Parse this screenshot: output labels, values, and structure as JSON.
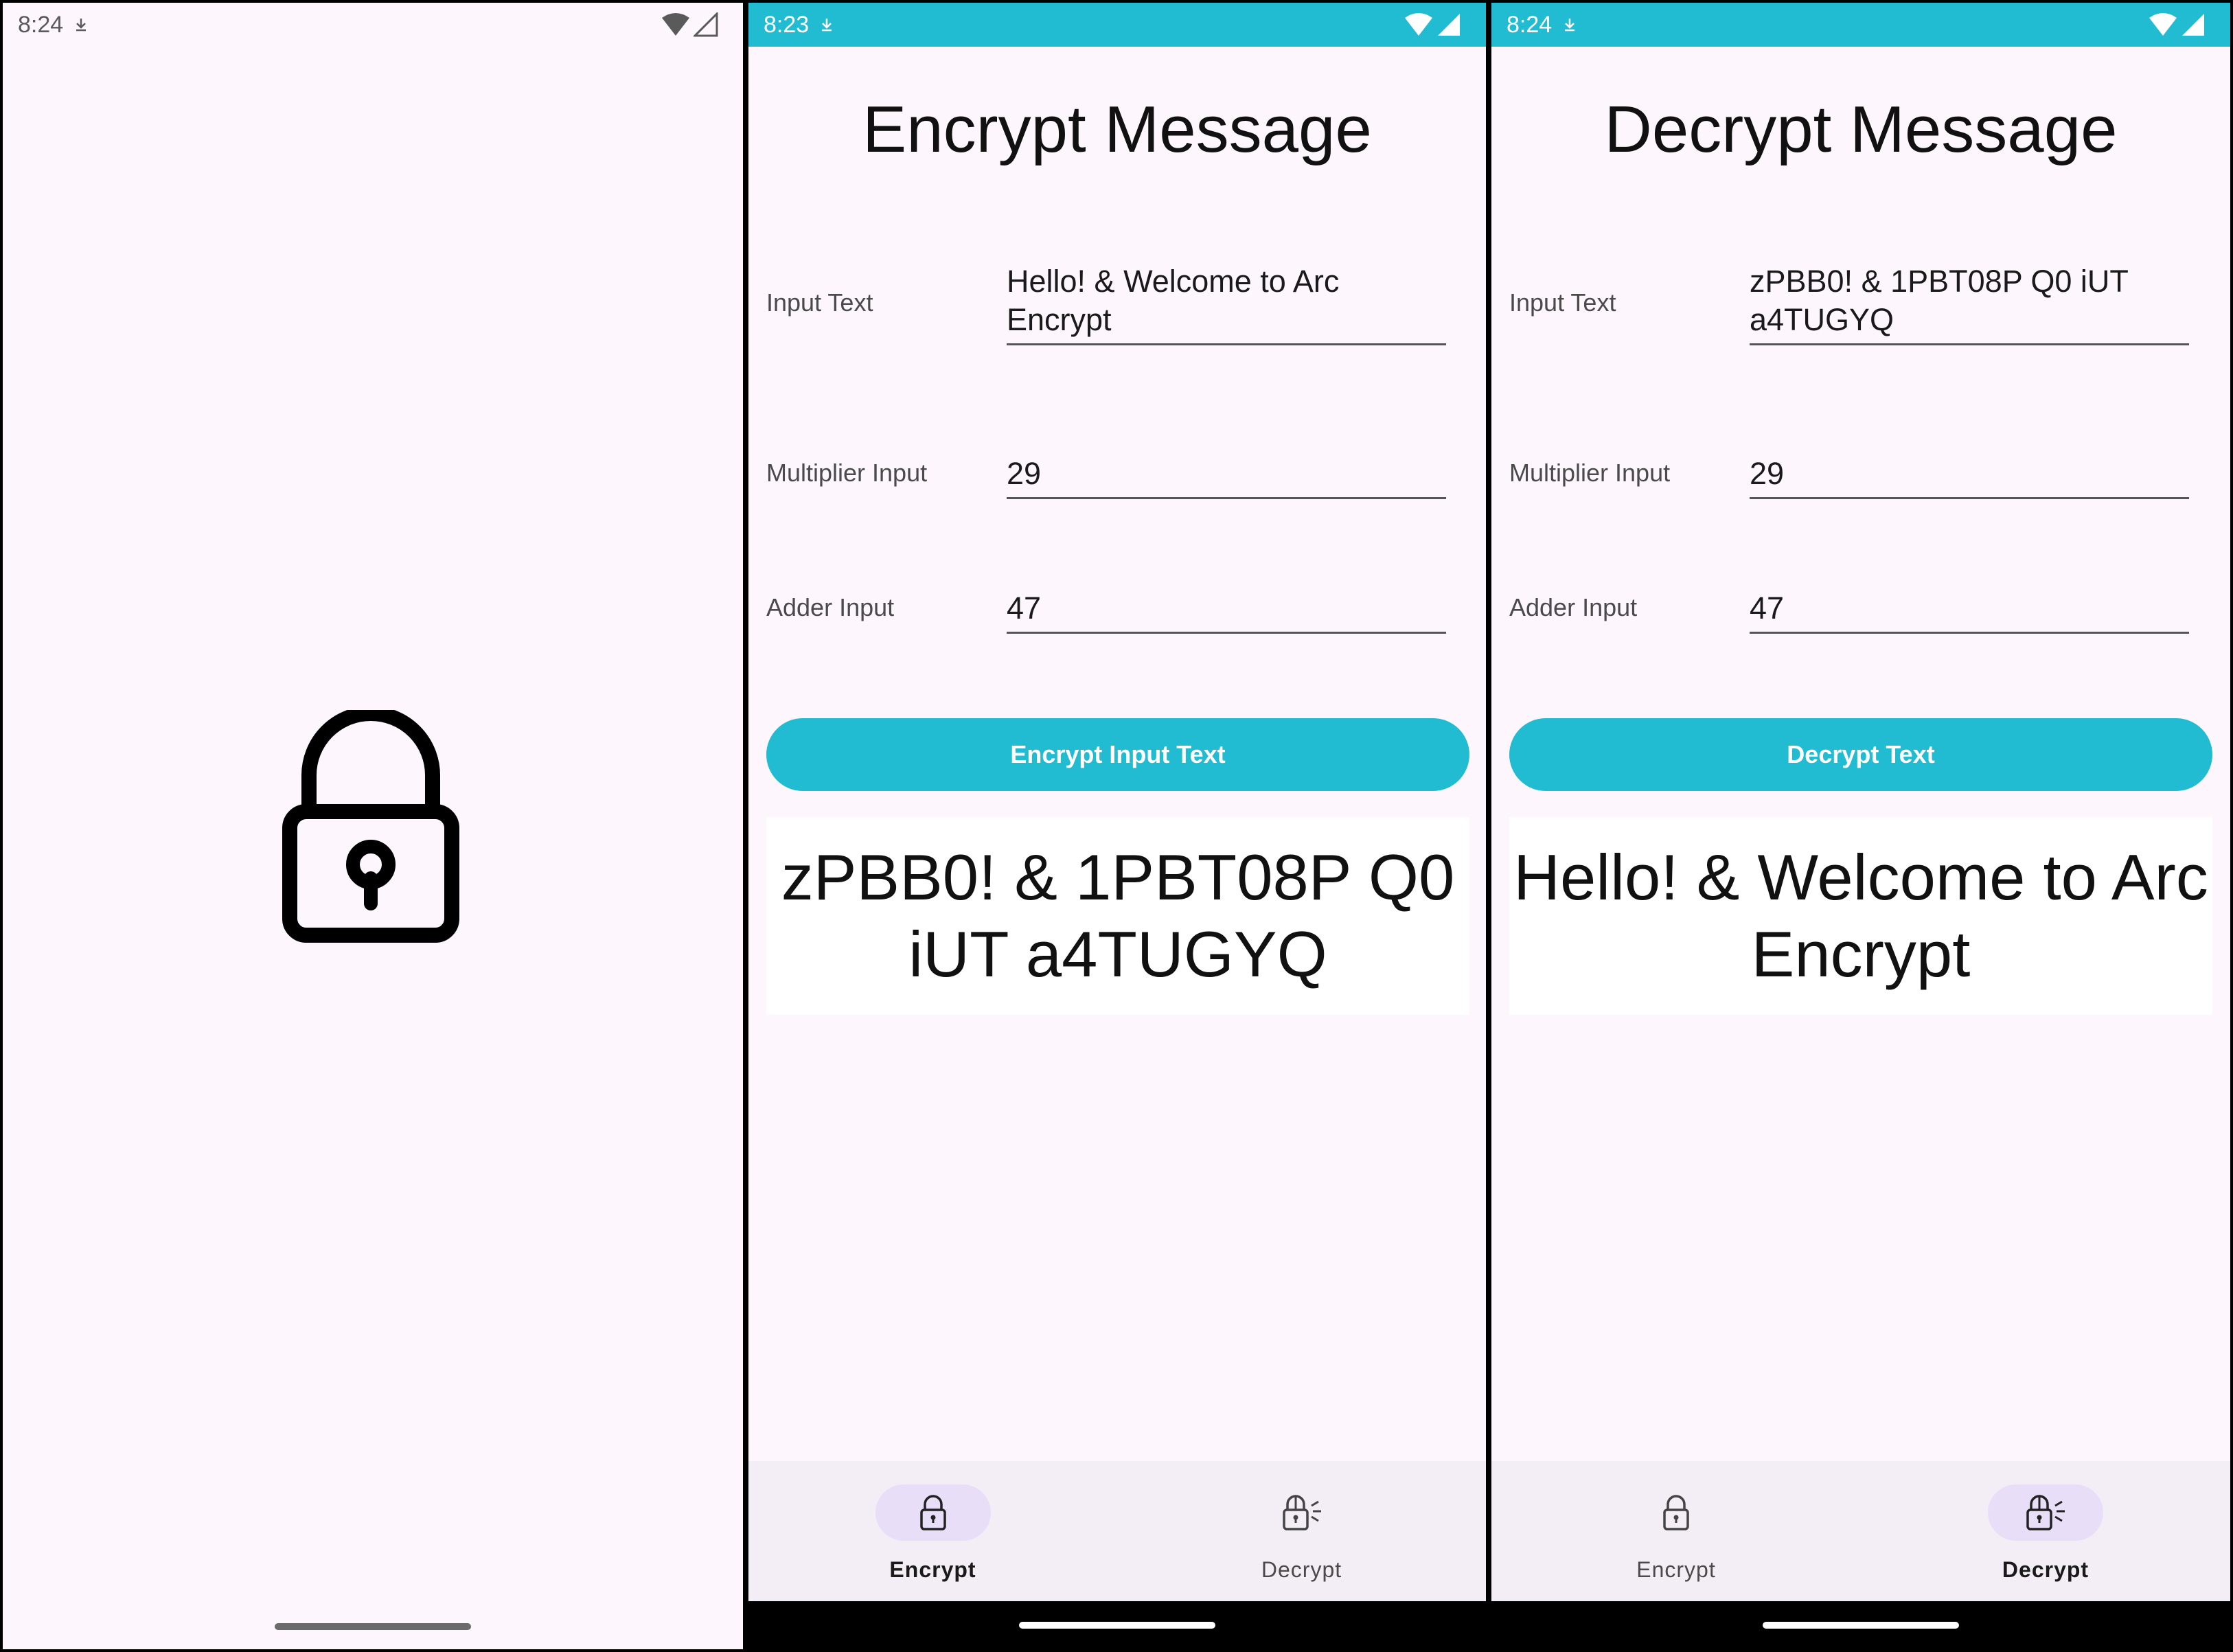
{
  "colors": {
    "accent": "#21BCD2",
    "background": "#FDF6FC",
    "nav_background": "#F3EDF6",
    "active_pill": "#E8DEF8"
  },
  "splash": {
    "status_time": "8:24",
    "icon": "lock-icon"
  },
  "encrypt": {
    "status_time": "8:23",
    "title": "Encrypt Message",
    "input_label": "Input Text",
    "input_value": "Hello! & Welcome to Arc Encrypt",
    "multiplier_label": "Multiplier Input",
    "multiplier_value": "29",
    "adder_label": "Adder Input",
    "adder_value": "47",
    "button_label": "Encrypt Input Text",
    "result": "zPBB0! & 1PBT08P Q0 iUT a4TUGYQ",
    "nav": [
      {
        "label": "Encrypt",
        "icon": "lock-icon",
        "active": true
      },
      {
        "label": "Decrypt",
        "icon": "unlock-icon",
        "active": false
      }
    ]
  },
  "decrypt": {
    "status_time": "8:24",
    "title": "Decrypt Message",
    "input_label": "Input Text",
    "input_value": "zPBB0! & 1PBT08P Q0 iUT a4TUGYQ",
    "multiplier_label": "Multiplier Input",
    "multiplier_value": "29",
    "adder_label": "Adder Input",
    "adder_value": "47",
    "button_label": "Decrypt Text",
    "result": "Hello! & Welcome to Arc Encrypt",
    "nav": [
      {
        "label": "Encrypt",
        "icon": "lock-icon",
        "active": false
      },
      {
        "label": "Decrypt",
        "icon": "unlock-icon",
        "active": true
      }
    ]
  }
}
